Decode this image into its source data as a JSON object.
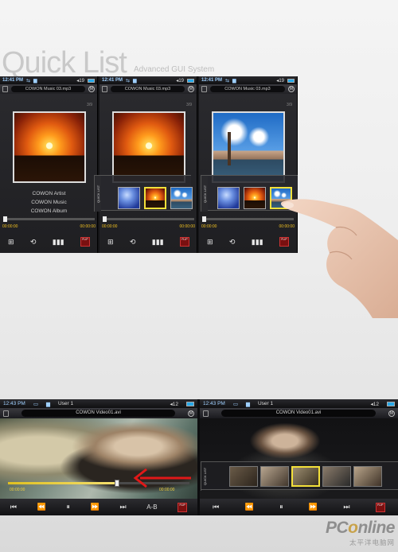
{
  "header": {
    "title": "Quick List",
    "subtitle": "Advanced GUI System"
  },
  "top_screens": [
    {
      "time": "12:41 PM",
      "volume": "19",
      "filename": "COWON Music 03.mp3",
      "track_count": "3/9",
      "artwork": "sunset-cyclists",
      "meta": [
        "COWON Artist",
        "COWON Music",
        "COWON Album"
      ],
      "elapsed": "00:00:00",
      "remaining": "00:00:00",
      "flip": "FLIP"
    },
    {
      "time": "12:41 PM",
      "volume": "19",
      "filename": "COWON Music 03.mp3",
      "track_count": "3/9",
      "artwork": "sunset-cyclists",
      "quick_list_tab": "QUICK LIST",
      "elapsed": "00:00:00",
      "remaining": "00:00:00",
      "flip": "FLIP"
    },
    {
      "time": "12:41 PM",
      "volume": "19",
      "filename": "COWON Music 03.mp3",
      "track_count": "3/9",
      "artwork": "city-skyline",
      "quick_list_tab": "QUICK LIST",
      "elapsed": "00:00:00",
      "remaining": "00:00:00",
      "flip": "FLIP"
    }
  ],
  "video_screens": [
    {
      "time": "12:43 PM",
      "user": "User 1",
      "volume": "12",
      "filename": "COWON Video01.avi",
      "elapsed": "00:00:00",
      "remaining": "00:00:00",
      "progress": 0.6,
      "ab_label": "A-B",
      "flip": "FLIP"
    },
    {
      "time": "12:43 PM",
      "user": "User 1",
      "volume": "12",
      "filename": "COWON Video01.avi",
      "quick_list_tab": "QUICK LIST",
      "flip": "FLIP"
    }
  ],
  "watermark": {
    "brand_pre": "PC",
    "brand_o": "o",
    "brand_post": "nline",
    "tagline": "太平洋电脑网"
  },
  "colors": {
    "accent_yellow": "#f3e03a",
    "status_blue": "#28a8e8",
    "flip_red": "#7a1010"
  }
}
